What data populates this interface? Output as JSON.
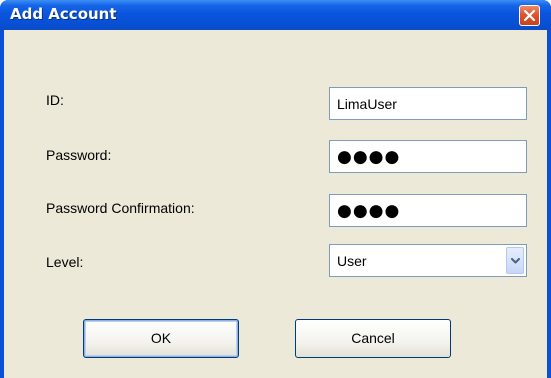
{
  "dialog": {
    "title": "Add Account",
    "close_icon": "close-icon"
  },
  "form": {
    "id_label": "ID:",
    "id_value": "LimaUser",
    "password_label": "Password:",
    "password_value": "●●●●",
    "confirm_label": "Password Confirmation:",
    "confirm_value": "●●●●",
    "level_label": "Level:",
    "level_value": "User"
  },
  "buttons": {
    "ok_label": "OK",
    "cancel_label": "Cancel"
  },
  "colors": {
    "titlebar": "#0a55dc",
    "client": "#ece9d8",
    "close": "#e0532f",
    "field_border": "#7f9db9"
  }
}
